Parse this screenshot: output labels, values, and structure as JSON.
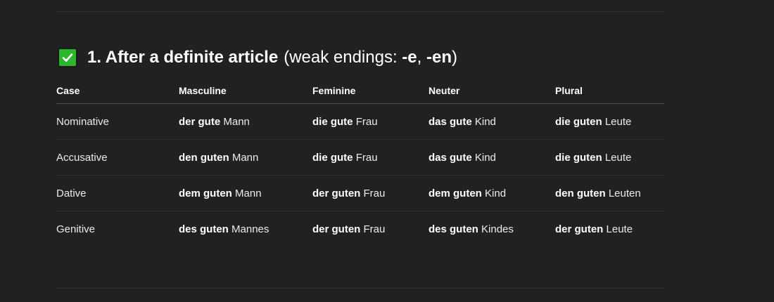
{
  "section": {
    "heading_emoji": "check-mark-button-icon",
    "heading_main": "1. After a definite article",
    "heading_open": "(weak endings: ",
    "ending_e": "-e",
    "heading_sep": ", ",
    "ending_en": "-en",
    "heading_close": ")"
  },
  "table": {
    "headers": [
      "Case",
      "Masculine",
      "Feminine",
      "Neuter",
      "Plural"
    ],
    "rows": [
      {
        "case": "Nominative",
        "masculine": {
          "phrase": "der gute",
          "noun": "Mann"
        },
        "feminine": {
          "phrase": "die gute",
          "noun": "Frau"
        },
        "neuter": {
          "phrase": "das gute",
          "noun": "Kind"
        },
        "plural": {
          "phrase": "die guten",
          "noun": "Leute"
        }
      },
      {
        "case": "Accusative",
        "masculine": {
          "phrase": "den guten",
          "noun": "Mann"
        },
        "feminine": {
          "phrase": "die gute",
          "noun": "Frau"
        },
        "neuter": {
          "phrase": "das gute",
          "noun": "Kind"
        },
        "plural": {
          "phrase": "die guten",
          "noun": "Leute"
        }
      },
      {
        "case": "Dative",
        "masculine": {
          "phrase": "dem guten",
          "noun": "Mann"
        },
        "feminine": {
          "phrase": "der guten",
          "noun": "Frau"
        },
        "neuter": {
          "phrase": "dem guten",
          "noun": "Kind"
        },
        "plural": {
          "phrase": "den guten",
          "noun": "Leuten"
        }
      },
      {
        "case": "Genitive",
        "masculine": {
          "phrase": "des guten",
          "noun": "Mannes"
        },
        "feminine": {
          "phrase": "der guten",
          "noun": "Frau"
        },
        "neuter": {
          "phrase": "des guten",
          "noun": "Kindes"
        },
        "plural": {
          "phrase": "der guten",
          "noun": "Leute"
        }
      }
    ]
  },
  "colors": {
    "background": "#212121",
    "text": "#ececec",
    "check_green": "#2db52d"
  }
}
